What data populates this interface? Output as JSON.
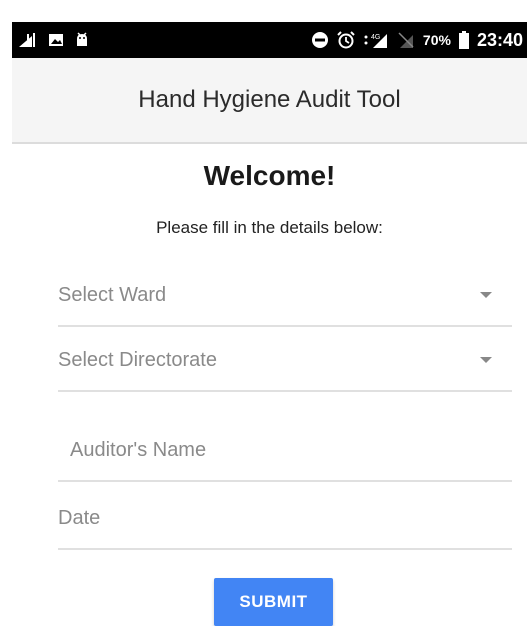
{
  "status_bar": {
    "left_icons": [
      "signal-app-icon",
      "image-icon",
      "android-icon"
    ],
    "right_icons": [
      "do-not-disturb-icon",
      "alarm-icon",
      "signal-icon",
      "no-sim-icon",
      "battery-icon"
    ],
    "battery_text": "70%",
    "time": "23:40"
  },
  "app_bar": {
    "title": "Hand Hygiene Audit Tool"
  },
  "form": {
    "heading": "Welcome!",
    "instructions": "Please fill in the details below:",
    "ward_select": {
      "value": "Select Ward"
    },
    "directorate_select": {
      "value": "Select Directorate"
    },
    "auditor_name": {
      "placeholder": "Auditor's Name",
      "value": ""
    },
    "date": {
      "placeholder": "Date",
      "value": ""
    },
    "submit_label": "SUBMIT"
  },
  "colors": {
    "accent": "#4285f4",
    "status_bar": "#000000",
    "app_bar": "#f5f5f5"
  }
}
